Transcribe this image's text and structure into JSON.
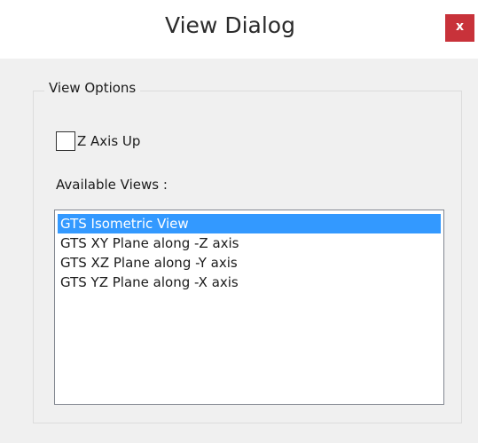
{
  "window": {
    "title": "View Dialog",
    "close_label": "x",
    "close_color": "#c8323a"
  },
  "group": {
    "legend": "View Options"
  },
  "checkbox": {
    "label": "Z Axis Up",
    "checked": false
  },
  "views": {
    "label": "Available Views :",
    "selected_index": 0,
    "selection_color": "#3399ff",
    "items": [
      "GTS Isometric View",
      "GTS XY Plane along -Z axis",
      "GTS XZ Plane along -Y axis",
      "GTS YZ Plane along -X axis"
    ]
  }
}
